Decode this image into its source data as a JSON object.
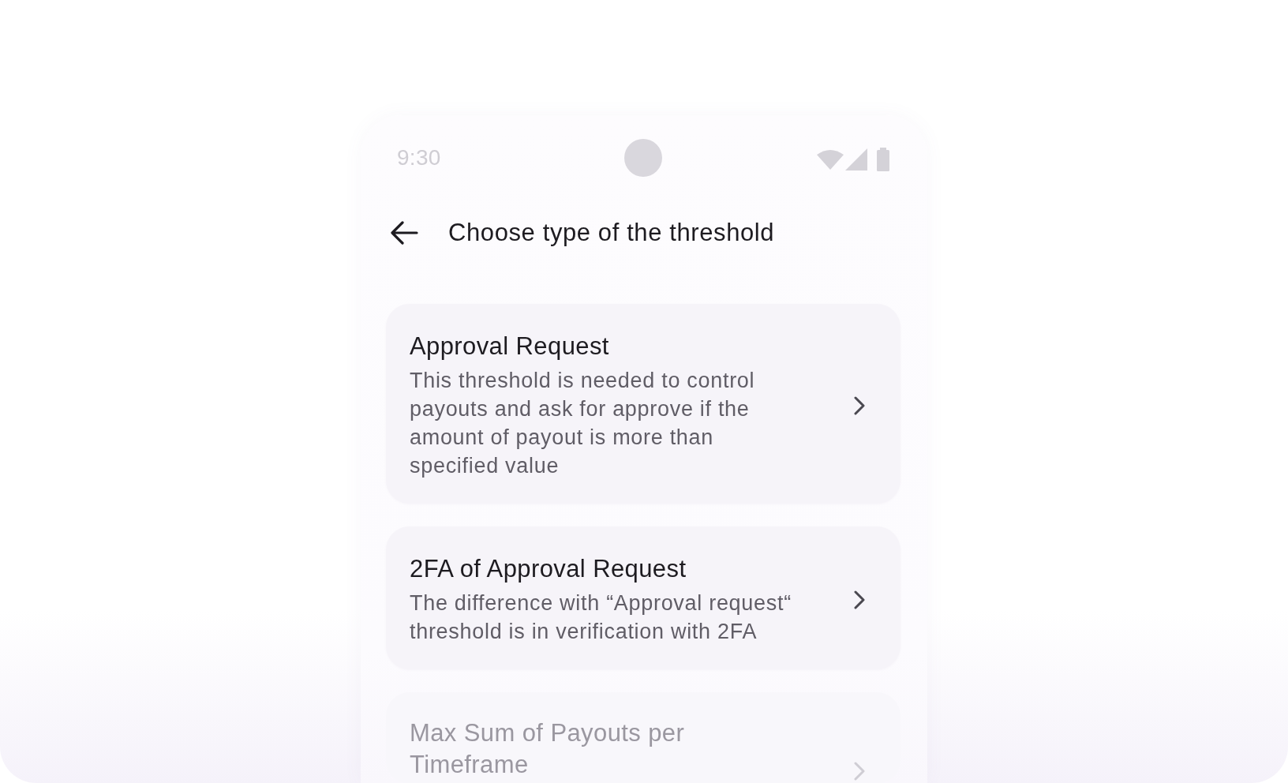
{
  "status_bar": {
    "time": "9:30"
  },
  "app_bar": {
    "title": "Choose type of the threshold"
  },
  "options": [
    {
      "title": "Approval Request",
      "description": "This threshold is needed to control payouts and ask for approve if the amount of payout is more than specified value",
      "faded": false
    },
    {
      "title": "2FA of Approval Request",
      "description": "The difference with “Approval request“ threshold is in verification with 2FA",
      "faded": false
    },
    {
      "title": "Max Sum of Payouts per Timeframe",
      "faded": true
    }
  ]
}
